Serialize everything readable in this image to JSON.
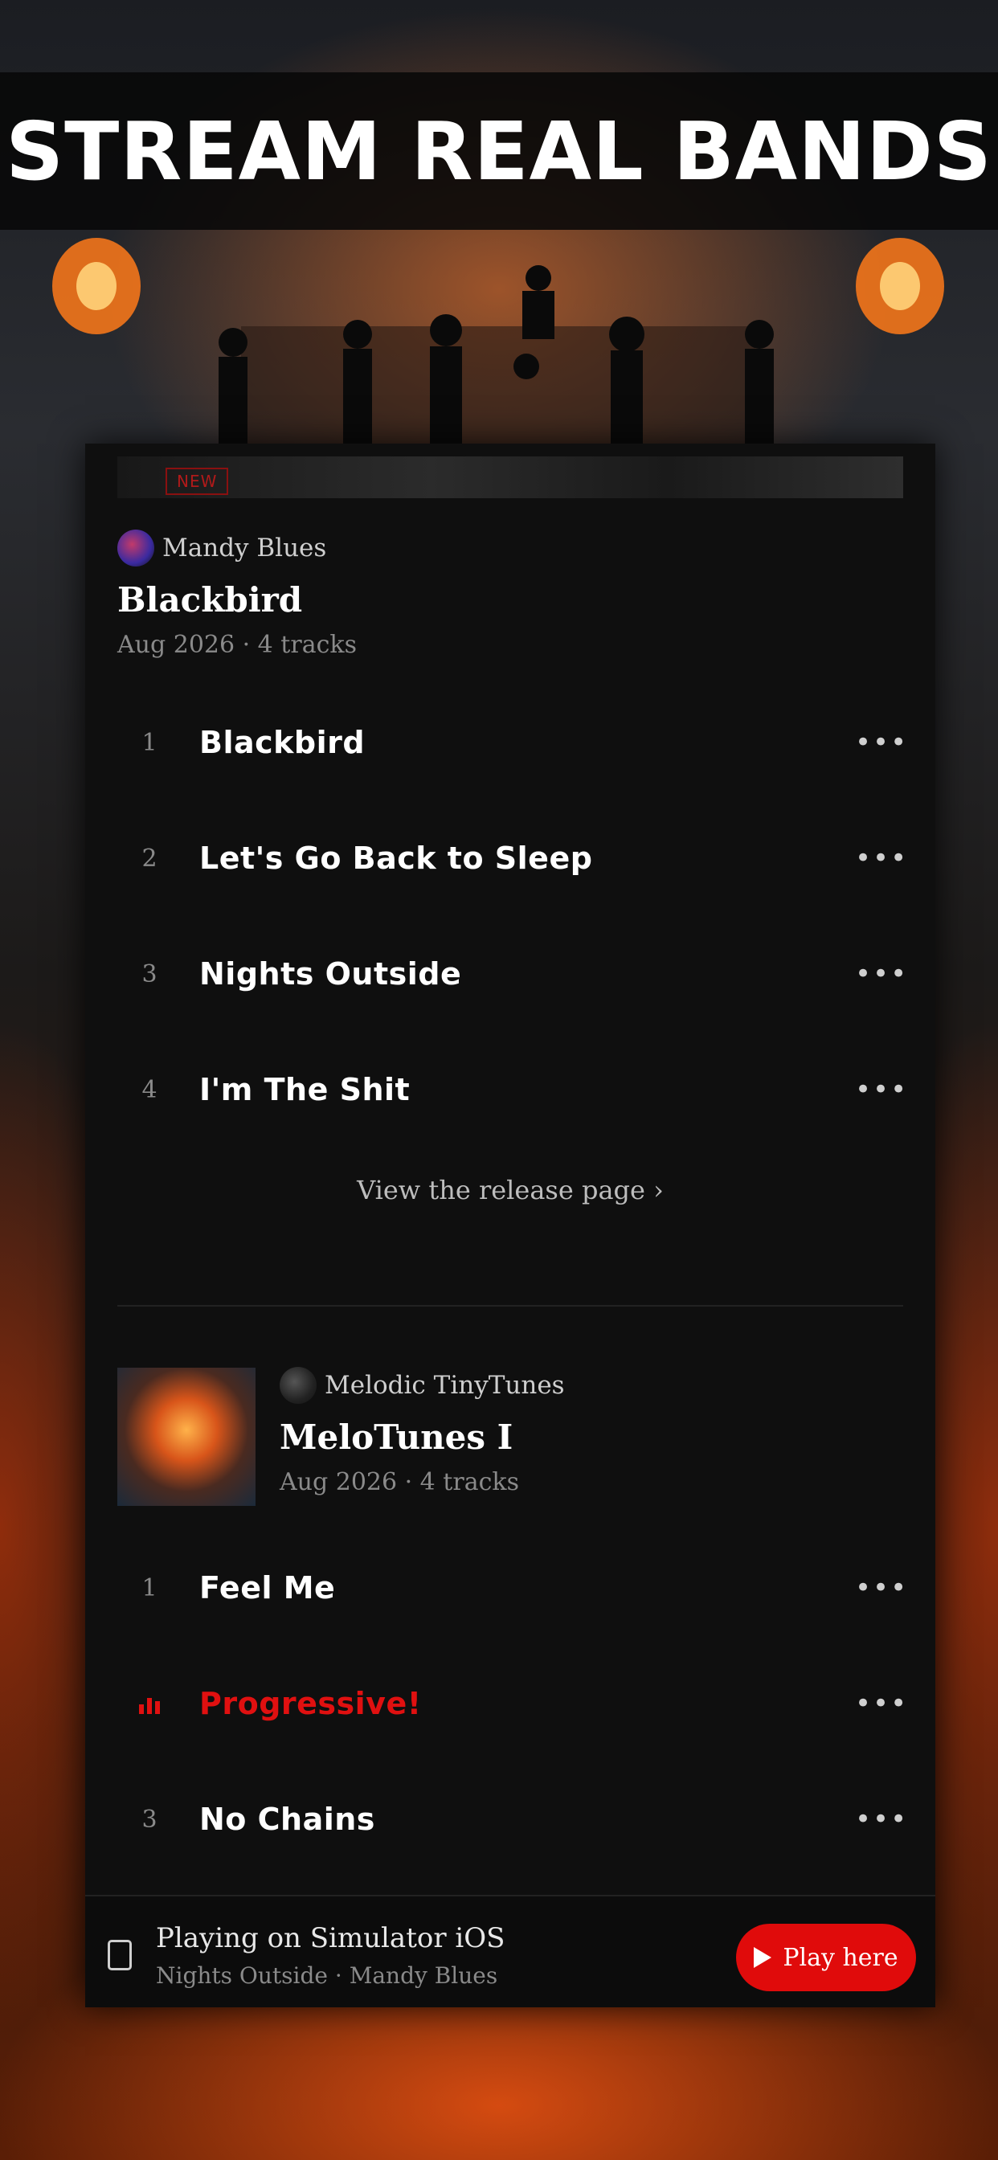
{
  "banner": {
    "title": "STREAM REAL BANDS"
  },
  "release1": {
    "badge": "NEW",
    "artist": "Mandy Blues",
    "title": "Blackbird",
    "meta": "Aug 2026 · 4 tracks",
    "tracks": [
      {
        "num": "1",
        "title": "Blackbird"
      },
      {
        "num": "2",
        "title": "Let's Go Back to Sleep"
      },
      {
        "num": "3",
        "title": "Nights Outside"
      },
      {
        "num": "4",
        "title": "I'm The Shit"
      }
    ],
    "more_glyph": "•••",
    "view_link": "View the release page  ›"
  },
  "release2": {
    "artist": "Melodic TinyTunes",
    "title": "MeloTunes I",
    "meta": "Aug 2026 · 4 tracks",
    "tracks": [
      {
        "num": "1",
        "title": "Feel Me",
        "playing": false
      },
      {
        "num": "",
        "title": "Progressive!",
        "playing": true
      },
      {
        "num": "3",
        "title": "No Chains",
        "playing": false
      }
    ]
  },
  "player": {
    "title": "Playing on Simulator iOS",
    "subtitle": "Nights Outside · Mandy Blues",
    "button_label": "Play here",
    "icon": "device-phone-icon"
  },
  "colors": {
    "accent": "#e00b0b",
    "panel": "#0f0f0f",
    "muted": "#8a8a8a"
  }
}
